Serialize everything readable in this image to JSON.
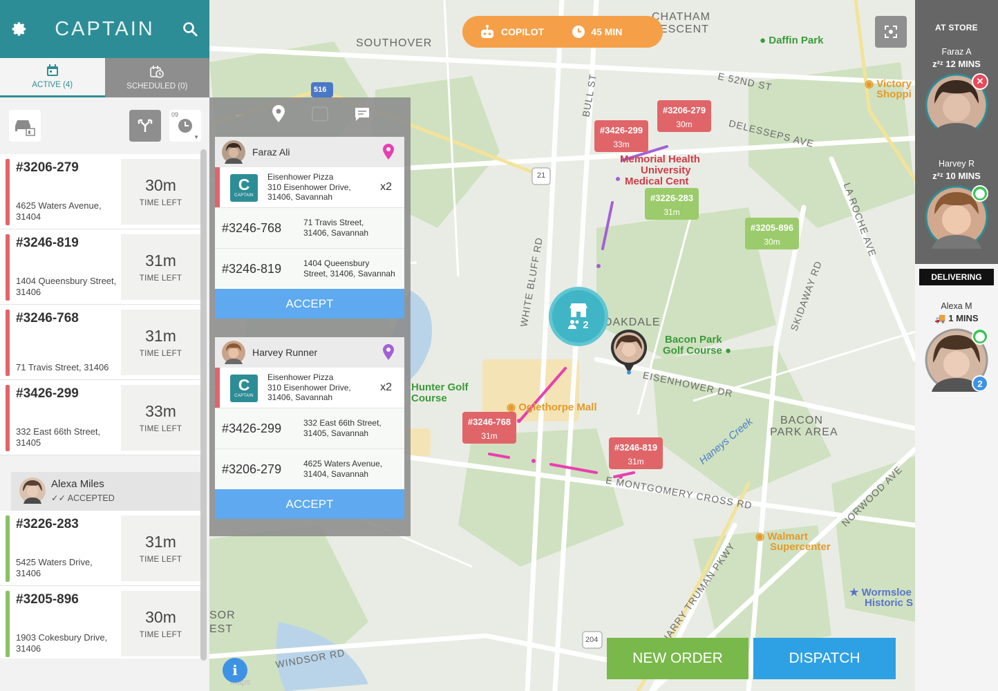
{
  "app": {
    "logo": "CAPTAIN"
  },
  "tabs": [
    {
      "label": "ACTIVE (4)"
    },
    {
      "label": "SCHEDULED (0)"
    }
  ],
  "filters": {
    "time_badge": "09"
  },
  "orders_top": [
    {
      "id": "#3206-279",
      "address": "4625 Waters Avenue, 31404",
      "time": "30m",
      "time_label": "TIME LEFT",
      "status_color": "#e06569"
    },
    {
      "id": "#3246-819",
      "address": "1404 Queensbury Street, 31406",
      "time": "31m",
      "time_label": "TIME LEFT",
      "status_color": "#e06569"
    },
    {
      "id": "#3246-768",
      "address": "71 Travis Street, 31406",
      "time": "31m",
      "time_label": "TIME LEFT",
      "status_color": "#e06569"
    },
    {
      "id": "#3426-299",
      "address": "332 East 66th Street, 31405",
      "time": "33m",
      "time_label": "TIME LEFT",
      "status_color": "#e06569"
    }
  ],
  "accepted_driver": {
    "name": "Alexa Miles",
    "status": "ACCEPTED"
  },
  "orders_bottom": [
    {
      "id": "#3226-283",
      "address": "5425 Waters Drive, 31406",
      "time": "31m",
      "time_label": "TIME LEFT",
      "status_color": "#8cc163"
    },
    {
      "id": "#3205-896",
      "address": "1903 Cokesbury Drive, 31406",
      "time": "30m",
      "time_label": "TIME LEFT",
      "status_color": "#8cc163"
    }
  ],
  "copilot": {
    "label": "COPILOT",
    "time": "45 MIN"
  },
  "map_labels": {
    "southover": "SOUTHOVER",
    "chatham": "CHATHAM",
    "crescent": "ESCENT",
    "daffin": "Daffin Park",
    "victory": "Victory",
    "shoppi": "Shoppi",
    "e52": "E 52ND ST",
    "delesseps": "DELESSEPS AVE",
    "bull": "BULL ST",
    "memorial1": "Memorial Health",
    "memorial2": "University",
    "memorial3": "Medical Cent",
    "rt21": "21",
    "rt516": "516",
    "rt204": "204",
    "laroche": "LA ROCHE AVE",
    "skidaway": "SKIDAWAY RD",
    "whitebluff": "WHITE BLUFF RD",
    "oakdale": "OAKDALE",
    "bacon1": "Bacon Park",
    "bacon2": "Golf Course",
    "eisenhower": "EISENHOWER DR",
    "hunter1": "Hunter Golf",
    "hunter2": "Course",
    "oglethorpe": "Oglethorpe Mall",
    "baconarea1": "BACON",
    "baconarea2": "PARK AREA",
    "haneys": "Haneys Creek",
    "montgomery": "E MONTGOMERY CROSS RD",
    "norwood": "NORWOOD AVE",
    "walmart1": "Walmart",
    "walmart2": "Supercenter",
    "truman": "HARRY TRUMAN PKWY",
    "wormsloe1": "Wormsloe",
    "wormsloe2": "Historic S",
    "windsor": "WINDSOR RD",
    "sor": "SOR",
    "est": "EST",
    "maps": "Maps"
  },
  "map_pins": [
    {
      "id": "#3206-279",
      "time": "30m",
      "color": "red"
    },
    {
      "id": "#3426-299",
      "time": "33m",
      "color": "red"
    },
    {
      "id": "#3226-283",
      "time": "31m",
      "color": "green"
    },
    {
      "id": "#3205-896",
      "time": "30m",
      "color": "green"
    },
    {
      "id": "#3246-768",
      "time": "31m",
      "color": "red"
    },
    {
      "id": "#3246-819",
      "time": "31m",
      "color": "red"
    }
  ],
  "store_pin": {
    "count": "2"
  },
  "popup": {
    "groups": [
      {
        "driver": "Faraz Ali",
        "store_name": "Eisenhower Pizza",
        "store_address": "310 Eisenhower Drive, 31406, Savannah",
        "store_address_line1": "310 Eisenhower Drive,",
        "store_address_line2": "31406, Savannah",
        "multiplier": "x2",
        "loc_color": "#e83fb0",
        "orders": [
          {
            "id": "#3246-768",
            "address_line1": "71 Travis Street,",
            "address_line2": "31406, Savannah"
          },
          {
            "id": "#3246-819",
            "address_line1": "1404 Queensbury",
            "address_line2": "Street, 31406, Savannah"
          }
        ],
        "accept_label": "ACCEPT"
      },
      {
        "driver": "Harvey Runner",
        "store_name": "Eisenhower Pizza",
        "store_address_line1": "310 Eisenhower Drive,",
        "store_address_line2": "31406, Savannah",
        "multiplier": "x2",
        "loc_color": "#a360d6",
        "orders": [
          {
            "id": "#3426-299",
            "address_line1": "332 East 66th Street,",
            "address_line2": "31405, Savannah"
          },
          {
            "id": "#3206-279",
            "address_line1": "4625 Waters Avenue,",
            "address_line2": "31404, Savannah"
          }
        ],
        "accept_label": "ACCEPT"
      }
    ],
    "captain_small": "CAPTAIN"
  },
  "actions": {
    "new_order": "NEW ORDER",
    "dispatch": "DISPATCH",
    "info": "i"
  },
  "right_panel": {
    "at_store_title": "AT STORE",
    "at_store": [
      {
        "name": "Faraz A",
        "wait": "12 MINS"
      },
      {
        "name": "Harvey R",
        "wait": "10 MINS"
      }
    ],
    "delivering_title": "DELIVERING",
    "delivering": [
      {
        "name": "Alexa M",
        "wait": "1 MINS",
        "count": "2"
      }
    ],
    "zzz": "z²ᶻ"
  }
}
